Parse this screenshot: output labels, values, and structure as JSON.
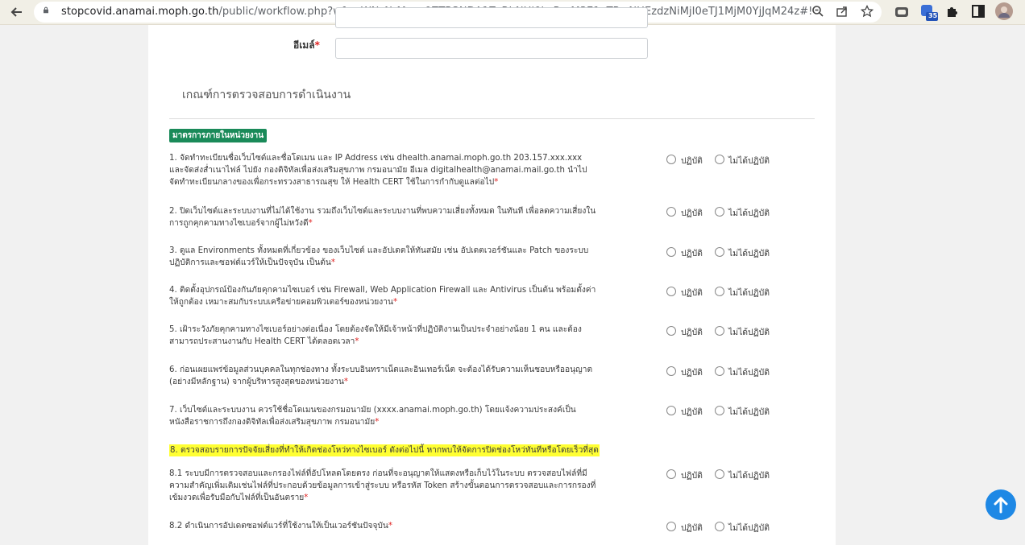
{
  "browser": {
    "url_host": "stopcovid.anamai.moph.go.th",
    "url_path": "/public/workflow.php?wfp=WNzNrMmw0ZTR3NDA1ZzRhNHl0bzRmM3E1aTRwNHEzdzNiMjI0eTJ1MjM0YjJqM24z#!",
    "extension_badge": "35"
  },
  "form": {
    "email_label": "อีเมล์",
    "required_mark": "*",
    "section_title": "เกณฑ์การตรวจสอบการดำเนินงาน",
    "badge": "มาตรการภายในหน่วยงาน",
    "option_comply": "ปฏิบัติ",
    "option_not_comply": "ไม่ได้ปฏิบัติ",
    "highlight": "8. ตรวจสอบรายการปัจจัยเสี่ยงที่ทำให้เกิดช่องโหว่ทางไซเบอร์ ดังต่อไปนี้ หากพบให้จัดการปิดช่องโหว่ทันทีหรือโดยเร็วที่สุด",
    "questions": [
      {
        "text": "1. จัดทำทะเบียนชื่อเว็บไซต์และชื่อโดเมน และ IP Address เช่น dhealth.anamai.moph.go.th 203.157.xxx.xxx และจัดส่งส่ำเนาไฟล์ ไปยัง กองดิจิทัลเพื่อส่งเสริมสุขภาพ กรมอนามัย อีเมล digitalhealth@anamai.mail.go.th นำไปจัดทำทะเบียนกลางของเพื่อกระทรวงสาธารณสุข ให้ Health CERT ใช้ในการกำกับดูแลต่อไป"
      },
      {
        "text": "2. ปิดเว็บไซต์และระบบงานที่ไม่ได้ใช้งาน รวมถึงเว็บไซต์และระบบงานที่พบความเสี่ยงทั้งหมด ในทันที เพื่อลดความเสี่ยงในการถูกคุกคามทางไซเบอร์จากผู้ไม่หวังดี"
      },
      {
        "text": "3. ดูแล Environments ทั้งหมดที่เกี่ยวข้อง ของเว็บไซต์ และอัปเดตให้ทันสมัย เช่น อัปเดตเวอร์ชันและ Patch ของระบบปฏิบัติการและซอฟต์แวร์ให้เป็นปัจจุบัน เป็นต้น"
      },
      {
        "text": "4. ติดตั้งอุปกรณ์ป้องกันภัยคุกคามไซเบอร์ เช่น Firewall, Web Application Firewall และ Antivirus เป็นต้น พร้อมตั้งค่าให้ถูกต้อง เหมาะสมกับระบบเครือข่ายคอมพิวเตอร์ของหน่วยงาน"
      },
      {
        "text": "5. เฝ้าระวังภัยคุกคามทางไซเบอร์อย่างต่อเนื่อง โดยต้องจัดให้มีเจ้าหน้าที่ปฏิบัติงานเป็นประจำอย่างน้อย 1 คน และต้องสามารถประสานงานกับ Health CERT ได้ตลอดเวลา"
      },
      {
        "text": "6. ก่อนเผยแพร่ข้อมูลส่วนบุคคลในทุกช่องทาง ทั้งระบบอินทราเน็ตและอินเทอร์เน็ต จะต้องได้รับความเห็นชอบหรืออนุญาต (อย่างมีหลักฐาน) จากผู้บริหารสูงสุดของหน่วยงาน"
      },
      {
        "text": "7. เว็บไซต์และระบบงาน ควรใช้ชื่อโดเมนของกรมอนามัย (xxxx.anamai.moph.go.th) โดยแจ้งความประสงค์เป็นหนังสือราชการถึงกองดิจิทัลเพื่อส่งเสริมสุขภาพ กรมอนามัย"
      },
      {
        "text": "8.1 ระบบมีการตรวจสอบและกรองไฟล์ที่อัปโหลดโดยตรง ก่อนที่จะอนุญาตให้แสดงหรือเก็บไว้ในระบบ ตรวจสอบไฟล์ที่มีความสำคัญเพิ่มเติมเช่นไฟล์ที่ประกอบด้วยข้อมูลการเข้าสู่ระบบ หรือรหัส Token สร้างขั้นตอนการตรวจสอบและการกรองที่เข้มงวดเพื่อรับมือกับไฟล์ที่เป็นอันตราย"
      },
      {
        "text": "8.2 ดำเนินการอัปเดตซอฟต์แวร์ที่ใช้งานให้เป็นเวอร์ชันปัจจุบัน"
      }
    ]
  },
  "colors": {
    "accent": "#1a8a59",
    "required": "#e0201f",
    "highlight": "#ffff33",
    "fab": "#1e88e5"
  },
  "icons": [
    "back-arrow-icon",
    "reload-icon",
    "lock-icon",
    "zoom-icon",
    "share-icon",
    "star-icon",
    "extension-icon",
    "puzzle-icon",
    "sidebar-icon",
    "avatar",
    "arrow-up-icon"
  ]
}
